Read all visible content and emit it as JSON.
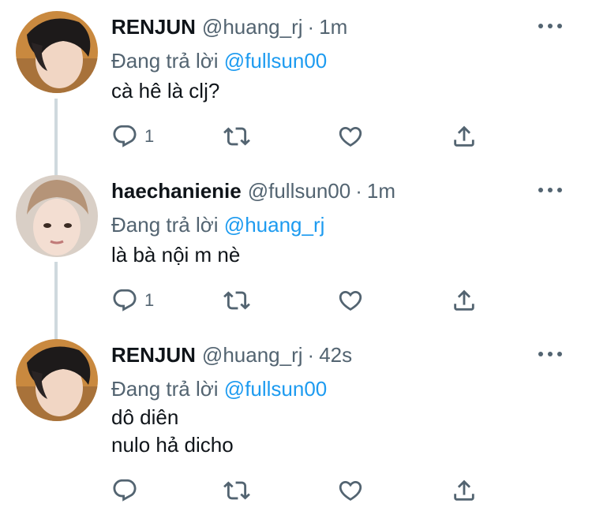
{
  "tweets": [
    {
      "name": "RENJUN",
      "handle": "@huang_rj",
      "dot": "·",
      "time": "1m",
      "replying_prefix": "Đang trả lời",
      "replying_to": "@fullsun00",
      "lines": [
        "cà hê là clj?"
      ],
      "reply_count": "1"
    },
    {
      "name": "haechanienie",
      "handle": "@fullsun00",
      "dot": "·",
      "time": "1m",
      "replying_prefix": "Đang trả lời",
      "replying_to": "@huang_rj",
      "lines": [
        "là bà nội m nè"
      ],
      "reply_count": "1"
    },
    {
      "name": "RENJUN",
      "handle": "@huang_rj",
      "dot": "·",
      "time": "42s",
      "replying_prefix": "Đang trả lời",
      "replying_to": "@fullsun00",
      "lines": [
        "dô diên",
        "nulo hả dicho"
      ],
      "reply_count": ""
    }
  ],
  "icons": {
    "reply": "reply-icon",
    "retweet": "retweet-icon",
    "like": "heart-icon",
    "share": "share-icon",
    "more": "more-icon"
  },
  "colors": {
    "text": "#0f1419",
    "secondary": "#536471",
    "link": "#1d9bf0",
    "thread_line": "#cfd9de"
  }
}
